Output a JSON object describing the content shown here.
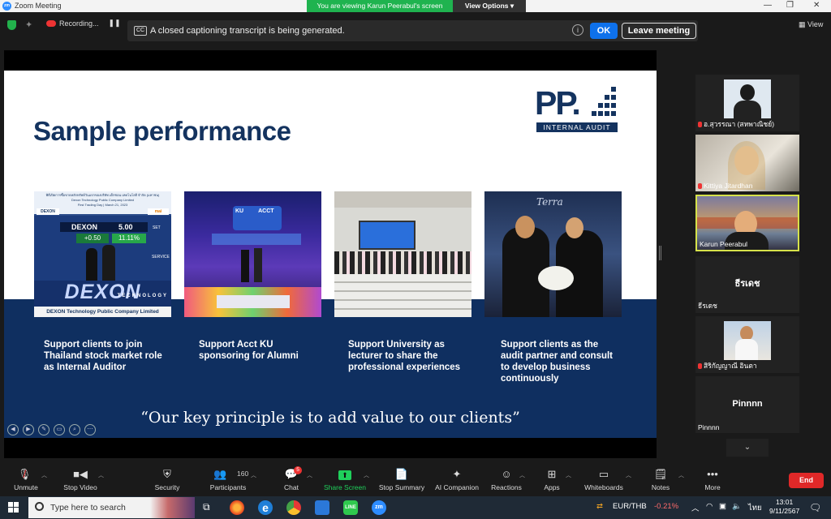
{
  "window": {
    "title": "Zoom Meeting",
    "minimize": "—",
    "maximize": "❐",
    "close": "✕"
  },
  "banner": {
    "viewing": "You are viewing Karun Peerabul's screen",
    "view_options": "View Options ▾"
  },
  "status": {
    "recording": "Recording...",
    "pause": "❚❚"
  },
  "cc": {
    "icon": "CC",
    "text": "A closed captioning transcript is being generated.",
    "info": "i",
    "ok": "OK",
    "leave": "Leave meeting"
  },
  "view_button": "View",
  "slide": {
    "title": "Sample performance",
    "logo_letters": "PP.",
    "logo_text": "INTERNAL AUDIT",
    "photo1": {
      "header": "พิธีเปิดการซื้อขายหลักทรัพย์วันแรกของบริษัท เด็กซอน เทคโนโลยี จำกัด (มหาชน)",
      "sub": "Dexon Technology Public Company Limited",
      "day": "First Trading Day | March 21, 2023",
      "ticker": "DEXON",
      "price": "5.00",
      "change": "+0.50",
      "pct": "11.11%",
      "board": "DEXON",
      "board2": "TECHNOLOGY",
      "board_footer": "DEXON Technology Public Company Limited",
      "mai": "mai",
      "set": "SET",
      "service": "SERVICE"
    },
    "photo2": {
      "ku": "KU",
      "acct": "ACCT"
    },
    "photo4": {
      "brand": "Terra"
    },
    "captions": [
      "Support clients to join Thailand stock market role as Internal Auditor",
      "Support Acct KU sponsoring for Alumni",
      "Support University as lecturer to share the professional experiences",
      "Support clients as the audit partner and consult to develop business continuously"
    ],
    "quote": "“Our key principle is to add value to our clients”"
  },
  "participants": [
    {
      "name": "อ.สุวรรณา (สหพาณิชย์)",
      "muted": true,
      "video": true
    },
    {
      "name": "Kittiya Jitardhan",
      "muted": true,
      "video": true
    },
    {
      "name": "Karun Peerabul",
      "muted": false,
      "video": true,
      "active": true
    },
    {
      "name": "ธีรเดช",
      "display": "ธีรเดช",
      "muted": false,
      "video": false
    },
    {
      "name": "สิริกัญญาณี อินตา",
      "muted": true,
      "video": true
    },
    {
      "name": "Pinnnn",
      "display": "Pinnnn",
      "muted": false,
      "video": false
    }
  ],
  "toolbar": {
    "unmute": "Unmute",
    "stop_video": "Stop Video",
    "security": "Security",
    "participants": "Participants",
    "participant_count": "160",
    "chat": "Chat",
    "chat_badge": "5",
    "share_screen": "Share Screen",
    "stop_summary": "Stop Summary",
    "ai_companion": "AI Companion",
    "reactions": "Reactions",
    "apps": "Apps",
    "whiteboards": "Whiteboards",
    "notes": "Notes",
    "more": "More",
    "end": "End"
  },
  "taskbar": {
    "search_placeholder": "Type here to search",
    "currency": "EUR/THB",
    "currency_change": "-0.21%",
    "lang": "ไทย",
    "time": "13:01",
    "date": "9/11/2567"
  },
  "colors": {
    "zoom_blue": "#0e71eb",
    "share_green": "#1fb34f",
    "end_red": "#e02828",
    "slide_navy": "#0f2f60"
  }
}
